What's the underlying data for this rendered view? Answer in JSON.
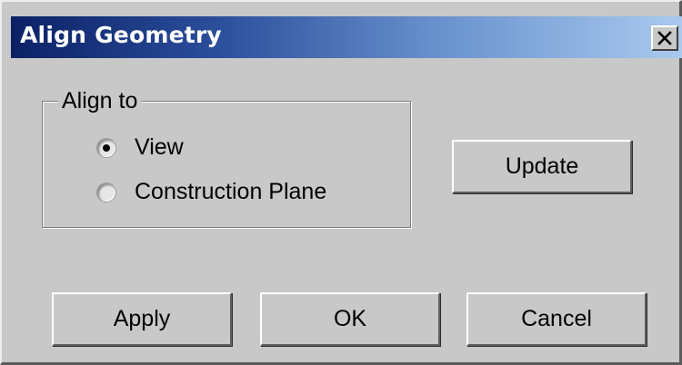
{
  "window": {
    "title": "Align Geometry",
    "close_label": "×"
  },
  "align_group": {
    "label": "Align to",
    "options": [
      {
        "label": "View",
        "selected": true
      },
      {
        "label": "Construction Plane",
        "selected": false
      }
    ]
  },
  "buttons": {
    "update": "Update",
    "apply": "Apply",
    "ok": "OK",
    "cancel": "Cancel"
  },
  "icons": {
    "close": "close-icon"
  },
  "colors": {
    "titlebar_start": "#0b2166",
    "titlebar_end": "#a9c9ee",
    "dialog_face": "#c8c8c8"
  }
}
